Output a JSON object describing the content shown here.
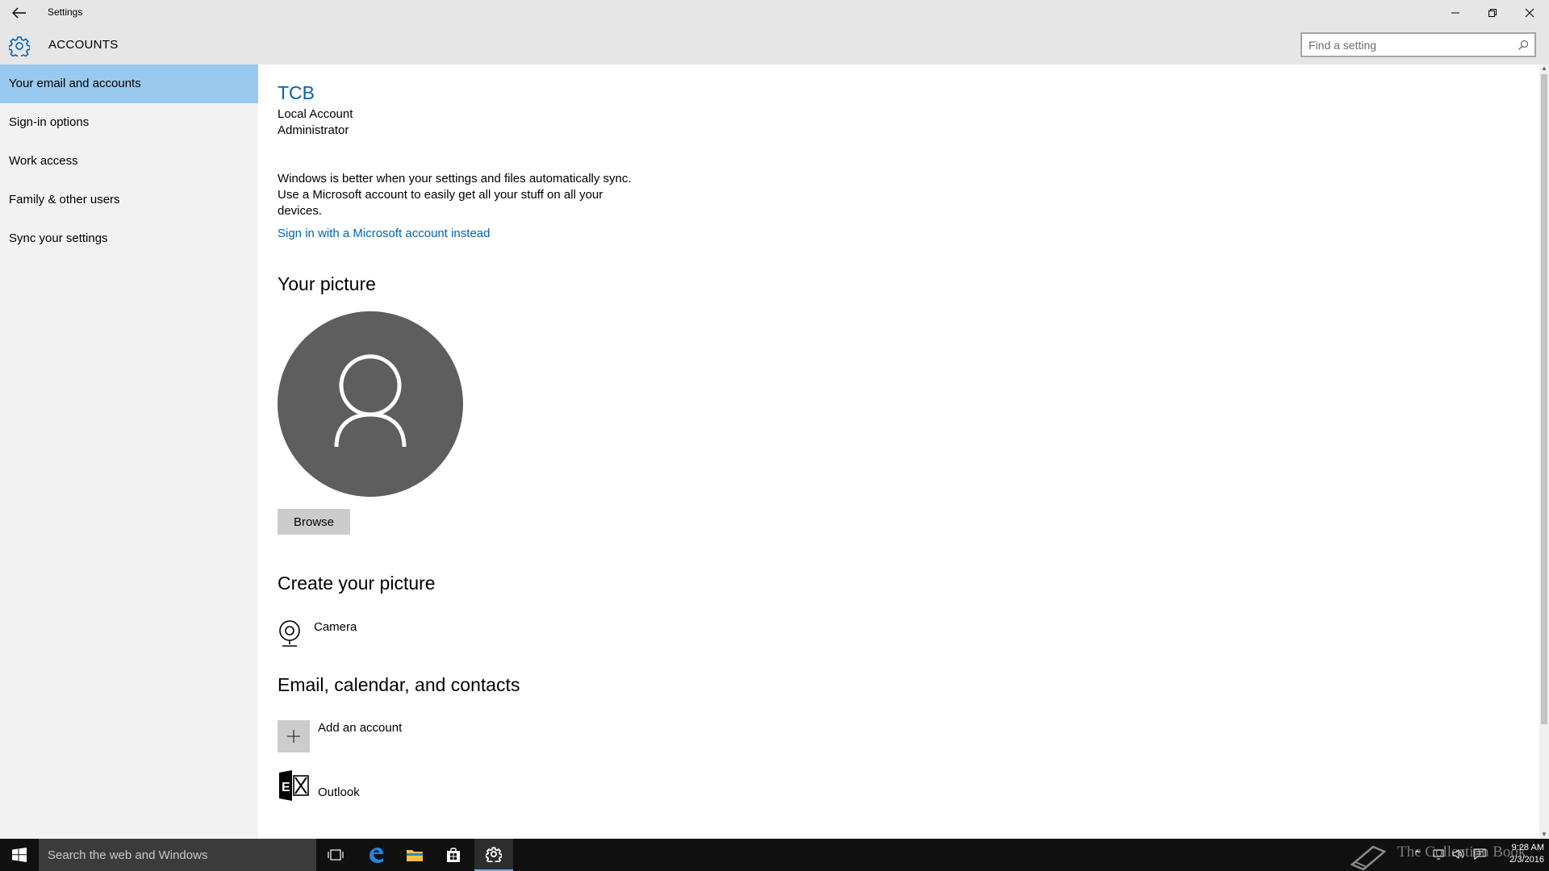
{
  "window": {
    "title": "Settings"
  },
  "header": {
    "app_title": "ACCOUNTS",
    "search_placeholder": "Find a setting"
  },
  "sidebar": {
    "items": [
      {
        "label": "Your email and accounts",
        "selected": true
      },
      {
        "label": "Sign-in options",
        "selected": false
      },
      {
        "label": "Work access",
        "selected": false
      },
      {
        "label": "Family & other users",
        "selected": false
      },
      {
        "label": "Sync your settings",
        "selected": false
      }
    ]
  },
  "account": {
    "name": "TCB",
    "type": "Local Account",
    "role": "Administrator",
    "sync_message": "Windows is better when your settings and files automatically sync. Use a Microsoft account to easily get all your stuff on all your devices.",
    "signin_link": "Sign in with a Microsoft account instead"
  },
  "picture": {
    "heading": "Your picture",
    "browse_label": "Browse"
  },
  "create_picture": {
    "heading": "Create your picture",
    "camera_label": "Camera"
  },
  "email_section": {
    "heading": "Email, calendar, and contacts",
    "add_account_label": "Add an account",
    "accounts": [
      {
        "label": "Outlook",
        "icon": "exchange-icon"
      }
    ]
  },
  "taskbar": {
    "search_placeholder": "Search the web and Windows",
    "watermark": "The Collection Book",
    "time": "9:28 AM",
    "date": "2/3/2016"
  },
  "colors": {
    "accent": "#0063b1",
    "selected_nav": "#99c9ee",
    "sidebar_bg": "#f2f2f2",
    "chrome_bg": "#e6e6e6",
    "avatar_bg": "#5e5e5e",
    "taskbar_bg": "#101010"
  }
}
